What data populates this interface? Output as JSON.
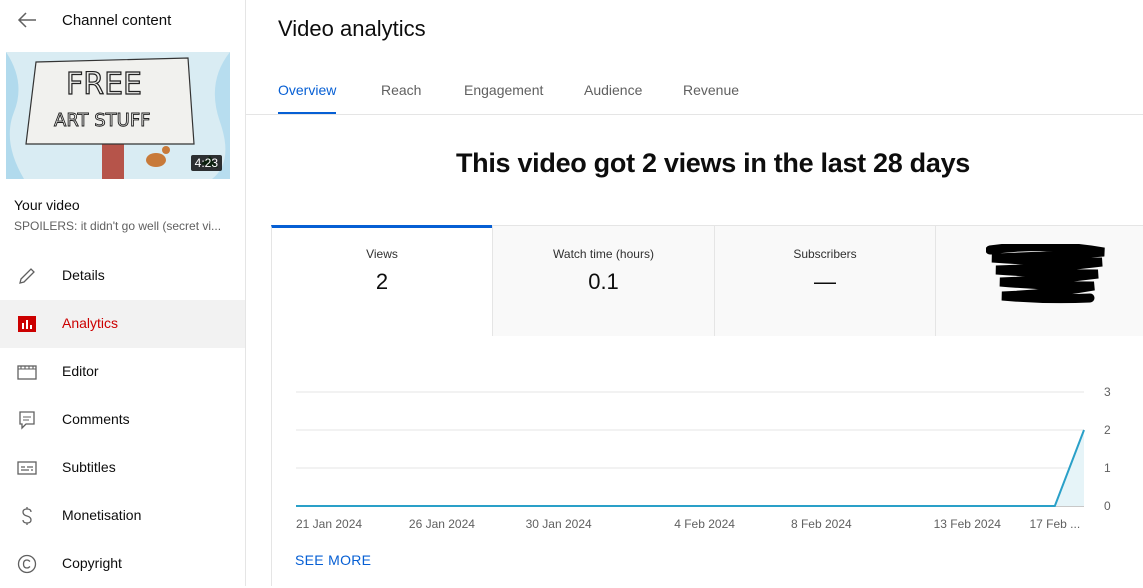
{
  "sidebar": {
    "header_title": "Channel content",
    "thumbnail": {
      "duration": "4:23",
      "drawn_text": [
        "FREE",
        "ART STUFF"
      ]
    },
    "your_video_label": "Your video",
    "video_title": "SPOILERS: it didn't go well (secret vi...",
    "items": [
      {
        "label": "Details",
        "icon": "pencil-icon"
      },
      {
        "label": "Analytics",
        "icon": "analytics-icon",
        "active": true
      },
      {
        "label": "Editor",
        "icon": "film-icon"
      },
      {
        "label": "Comments",
        "icon": "comments-icon"
      },
      {
        "label": "Subtitles",
        "icon": "subtitles-icon"
      },
      {
        "label": "Monetisation",
        "icon": "dollar-icon"
      },
      {
        "label": "Copyright",
        "icon": "copyright-icon"
      }
    ]
  },
  "main": {
    "title": "Video analytics",
    "tabs": [
      {
        "label": "Overview",
        "active": true
      },
      {
        "label": "Reach"
      },
      {
        "label": "Engagement"
      },
      {
        "label": "Audience"
      },
      {
        "label": "Revenue"
      }
    ],
    "headline": "This video got 2 views in the last 28 days",
    "metrics": [
      {
        "label": "Views",
        "value": "2",
        "active": true
      },
      {
        "label": "Watch time (hours)",
        "value": "0.1"
      },
      {
        "label": "Subscribers",
        "value": "—"
      },
      {
        "label": "",
        "value": "",
        "redacted": true
      }
    ],
    "see_more": "SEE MORE"
  },
  "colors": {
    "accent_blue": "#065fd4",
    "active_red": "#cc0000",
    "line": "#2aa0c8"
  },
  "chart_data": {
    "type": "area",
    "x": [
      "21 Jan 2024",
      "22 Jan 2024",
      "23 Jan 2024",
      "24 Jan 2024",
      "25 Jan 2024",
      "26 Jan 2024",
      "27 Jan 2024",
      "28 Jan 2024",
      "29 Jan 2024",
      "30 Jan 2024",
      "31 Jan 2024",
      "1 Feb 2024",
      "2 Feb 2024",
      "3 Feb 2024",
      "4 Feb 2024",
      "5 Feb 2024",
      "6 Feb 2024",
      "7 Feb 2024",
      "8 Feb 2024",
      "9 Feb 2024",
      "10 Feb 2024",
      "11 Feb 2024",
      "12 Feb 2024",
      "13 Feb 2024",
      "14 Feb 2024",
      "15 Feb 2024",
      "16 Feb 2024",
      "17 Feb 2024"
    ],
    "series": [
      {
        "values": [
          0,
          0,
          0,
          0,
          0,
          0,
          0,
          0,
          0,
          0,
          0,
          0,
          0,
          0,
          0,
          0,
          0,
          0,
          0,
          0,
          0,
          0,
          0,
          0,
          0,
          0,
          0,
          2
        ]
      }
    ],
    "tick_labels": [
      {
        "label": "21 Jan 2024",
        "index": 0
      },
      {
        "label": "26 Jan 2024",
        "index": 5
      },
      {
        "label": "30 Jan 2024",
        "index": 9
      },
      {
        "label": "4 Feb 2024",
        "index": 14
      },
      {
        "label": "8 Feb 2024",
        "index": 18
      },
      {
        "label": "13 Feb 2024",
        "index": 23
      },
      {
        "label": "17 Feb ...",
        "index": 26
      }
    ],
    "ylim": [
      0,
      3
    ],
    "yticks": [
      0,
      1,
      2,
      3
    ],
    "grid": true,
    "yaxis_side": "right"
  }
}
